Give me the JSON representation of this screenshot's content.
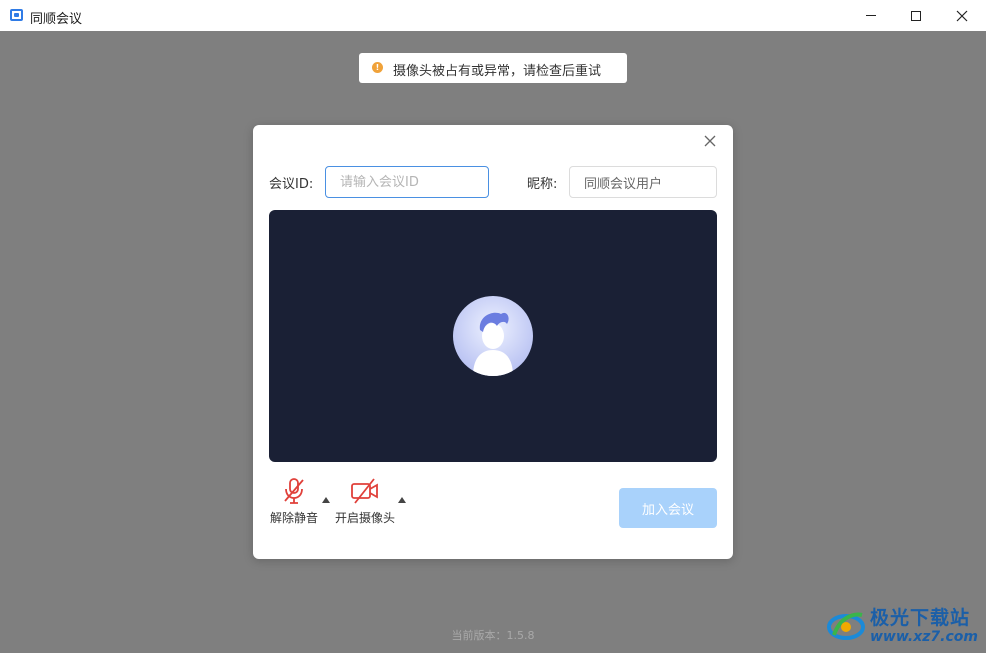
{
  "window": {
    "title": "同顺会议",
    "controls": [
      "minimize",
      "maximize",
      "close"
    ]
  },
  "toast": {
    "icon": "warning-icon",
    "icon_glyph": "!",
    "message": "摄像头被占有或异常，请检查后重试",
    "color": "#f0a23a"
  },
  "dialog": {
    "close_glyph": "✕",
    "meeting_id_label": "会议ID:",
    "meeting_id_placeholder": "请输入会议ID",
    "meeting_id_value": "",
    "nickname_label": "昵称:",
    "nickname_value": "同顺会议用户",
    "preview_bg": "#1a2035",
    "controls": {
      "mic_label": "解除静音",
      "camera_label": "开启摄像头",
      "icon_color": "#e0403a"
    },
    "join_button": "加入会议",
    "join_button_color": "#a9d2fb"
  },
  "footer": {
    "version": "当前版本：1.5.8"
  },
  "watermark": {
    "title": "极光下载站",
    "url": "www.xz7.com"
  }
}
